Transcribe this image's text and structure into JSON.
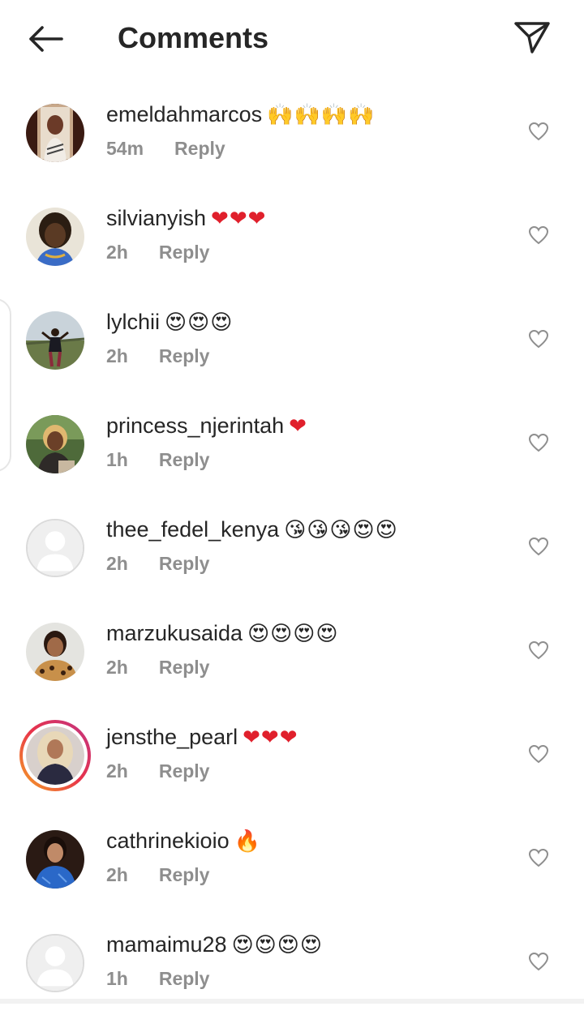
{
  "header": {
    "title": "Comments",
    "back_icon": "arrow-left-icon",
    "share_icon": "paper-plane-icon"
  },
  "colors": {
    "text": "#262626",
    "meta": "#8e8e8e",
    "heart_red": "#e0202c",
    "story_ring_start": "#f5a623",
    "story_ring_end": "#c13584"
  },
  "comments": [
    {
      "username": "emeldahmarcos",
      "emoji": "🙌🙌🙌🙌",
      "time": "54m",
      "reply": "Reply",
      "avatar": "photo",
      "ring": false
    },
    {
      "username": "silvianyish",
      "emoji": "❤❤❤",
      "time": "2h",
      "reply": "Reply",
      "avatar": "photo",
      "ring": false
    },
    {
      "username": "lylchii",
      "emoji": "😍😍😍",
      "time": "2h",
      "reply": "Reply",
      "avatar": "photo",
      "ring": false
    },
    {
      "username": "princess_njerintah",
      "emoji": "❤",
      "time": "1h",
      "reply": "Reply",
      "avatar": "photo",
      "ring": false
    },
    {
      "username": "thee_fedel_kenya",
      "emoji": "😘😘😘😍😍",
      "time": "2h",
      "reply": "Reply",
      "avatar": "default",
      "ring": false
    },
    {
      "username": "marzukusaida",
      "emoji": "😍😍😍😍",
      "time": "2h",
      "reply": "Reply",
      "avatar": "photo",
      "ring": false
    },
    {
      "username": "jensthe_pearl",
      "emoji": "❤❤❤",
      "time": "2h",
      "reply": "Reply",
      "avatar": "photo",
      "ring": true
    },
    {
      "username": "cathrinekioio",
      "emoji": "🔥",
      "time": "2h",
      "reply": "Reply",
      "avatar": "photo",
      "ring": false
    },
    {
      "username": "mamaimu28",
      "emoji": "😍😍😍😍",
      "time": "1h",
      "reply": "Reply",
      "avatar": "default",
      "ring": false
    }
  ]
}
